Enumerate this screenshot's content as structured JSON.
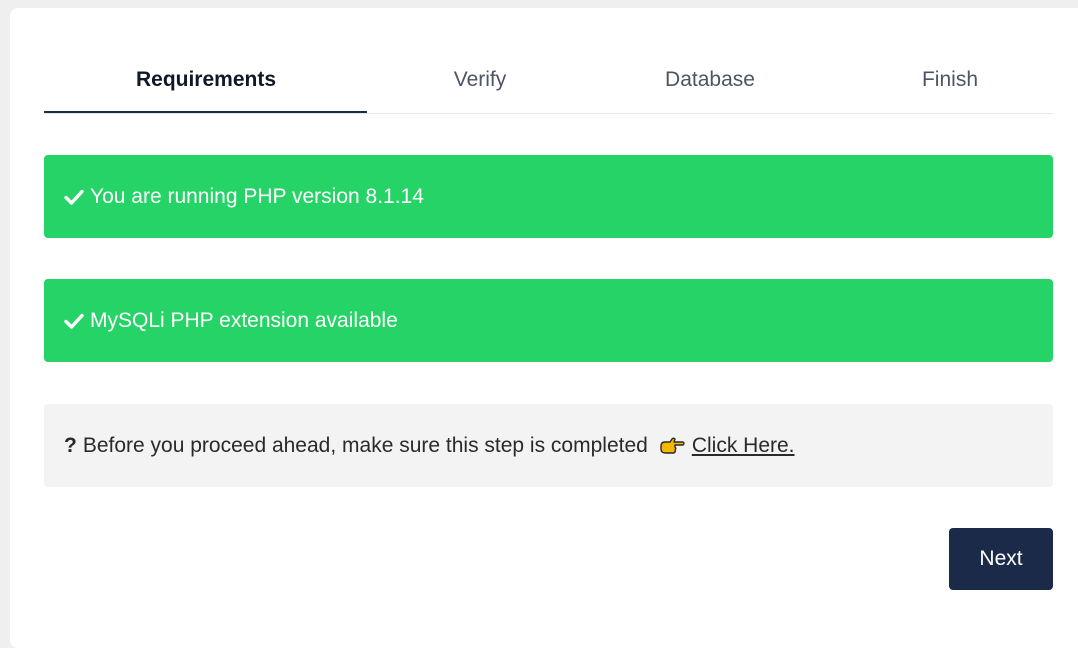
{
  "tabs": [
    {
      "label": "Requirements",
      "active": true
    },
    {
      "label": "Verify",
      "active": false
    },
    {
      "label": "Database",
      "active": false
    },
    {
      "label": "Finish",
      "active": false
    }
  ],
  "alerts": [
    {
      "text": "You are running PHP version 8.1.14",
      "icon": "check-icon"
    },
    {
      "text": "MySQLi PHP extension available",
      "icon": "check-icon"
    }
  ],
  "notice": {
    "prefix": "?",
    "text": "Before you proceed ahead, make sure this step is completed",
    "icon": "pointing-hand-icon",
    "link_text": "Click Here."
  },
  "next_button": {
    "label": "Next"
  },
  "colors": {
    "success": "#25d366",
    "primary": "#1c2a4a",
    "notice_bg": "#f3f3f3"
  }
}
